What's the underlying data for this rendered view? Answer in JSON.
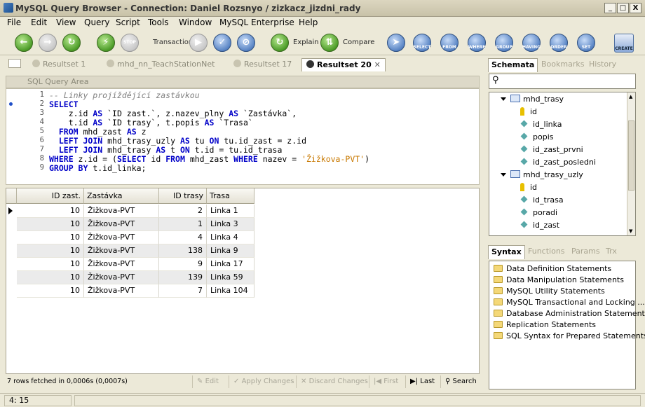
{
  "window": {
    "title": "MySQL Query Browser - Connection: Daniel Rozsnyo / zizkacz_jizdni_rady",
    "min": "_",
    "max": "□",
    "close": "X"
  },
  "menu": [
    "File",
    "Edit",
    "View",
    "Query",
    "Script",
    "Tools",
    "Window",
    "MySQL Enterprise",
    "Help"
  ],
  "toolbar": {
    "transaction_label": "Transaction",
    "explain_label": "Explain",
    "compare_label": "Compare",
    "clause_buttons": [
      "SELECT",
      "FROM",
      "WHERE",
      "GROUP",
      "HAVING",
      "ORDER",
      "SET"
    ],
    "create_label": "CREATE"
  },
  "tabs": [
    {
      "label": "Resultset 1"
    },
    {
      "label": "mhd_nn_TeachStationNet"
    },
    {
      "label": "Resultset 17"
    },
    {
      "label": "Resultset 20"
    }
  ],
  "sql_area": {
    "header": "SQL Query Area",
    "lines": [
      "1",
      "2",
      "3",
      "4",
      "5",
      "6",
      "7",
      "8",
      "9"
    ]
  },
  "grid": {
    "columns": [
      "ID zast.",
      "Zastávka",
      "ID trasy",
      "Trasa"
    ],
    "rows": [
      [
        "10",
        "Žižkova-PVT",
        "2",
        "Linka 1"
      ],
      [
        "10",
        "Žižkova-PVT",
        "1",
        "Linka 3"
      ],
      [
        "10",
        "Žižkova-PVT",
        "4",
        "Linka 4"
      ],
      [
        "10",
        "Žižkova-PVT",
        "138",
        "Linka 9"
      ],
      [
        "10",
        "Žižkova-PVT",
        "9",
        "Linka 17"
      ],
      [
        "10",
        "Žižkova-PVT",
        "139",
        "Linka 59"
      ],
      [
        "10",
        "Žižkova-PVT",
        "7",
        "Linka 104"
      ]
    ]
  },
  "gridbar": {
    "status": "7 rows fetched in 0,0006s (0,0007s)",
    "edit": "Edit",
    "apply": "Apply Changes",
    "discard": "Discard Changes",
    "first": "First",
    "last": "Last",
    "search": "Search"
  },
  "statusbar": {
    "position": "4: 15"
  },
  "right": {
    "tabs": [
      "Schemata",
      "Bookmarks",
      "History"
    ],
    "tree": [
      {
        "type": "table",
        "label": "mhd_trasy"
      },
      {
        "type": "key",
        "label": "id"
      },
      {
        "type": "col",
        "label": "id_linka"
      },
      {
        "type": "col",
        "label": "popis"
      },
      {
        "type": "col",
        "label": "id_zast_prvni"
      },
      {
        "type": "col",
        "label": "id_zast_posledni"
      },
      {
        "type": "table",
        "label": "mhd_trasy_uzly"
      },
      {
        "type": "key",
        "label": "id"
      },
      {
        "type": "col",
        "label": "id_trasa"
      },
      {
        "type": "col",
        "label": "poradi"
      },
      {
        "type": "col",
        "label": "id_zast"
      }
    ],
    "syntax_tabs": [
      "Syntax",
      "Functions",
      "Params",
      "Trx"
    ],
    "syntax_items": [
      "Data Definition Statements",
      "Data Manipulation Statements",
      "MySQL Utility Statements",
      "MySQL Transactional and Locking ...",
      "Database Administration Statements",
      "Replication Statements",
      "SQL Syntax for Prepared Statements"
    ]
  },
  "colors": {
    "keyword": "#0000c8",
    "string": "#c87800",
    "comment": "#808080",
    "alt_row": "#ebebeb"
  }
}
